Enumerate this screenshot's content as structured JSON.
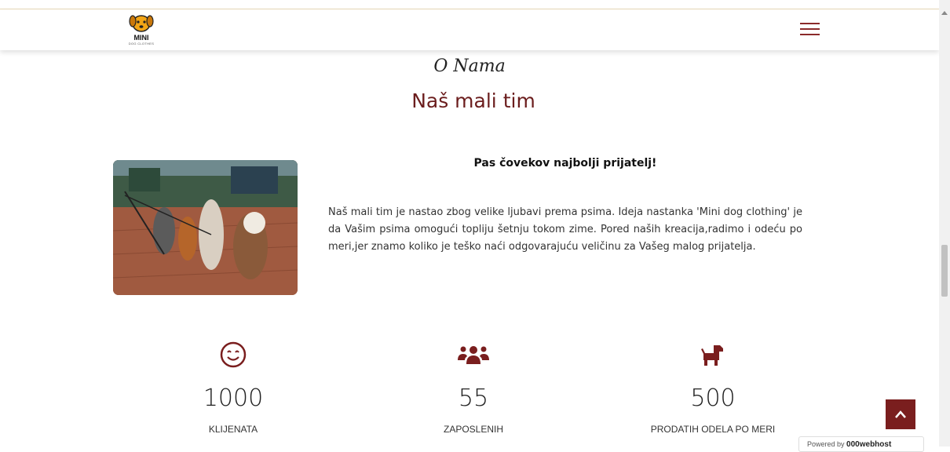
{
  "header": {
    "logo_title": "MINI",
    "logo_subtitle": "DOG CLOTHES",
    "menu_icon": "hamburger-icon"
  },
  "about": {
    "subtitle": "O Nama",
    "title": "Naš mali tim",
    "heading": "Pas čovekov najbolji prijatelj!",
    "text": "Naš mali tim je nastao zbog velike ljubavi prema psima. Ideja nastanka 'Mini dog clothing' je da Vašim psima omogući topliju šetnju tokom zime. Pored naših kreacija,radimo i odeću po meri,jer znamo koliko je teško naći odgovarajuću veličinu za Vašeg malog prijatelja."
  },
  "stats": [
    {
      "icon": "smile-icon",
      "number": "1000",
      "label": "KLIJENATA"
    },
    {
      "icon": "users-icon",
      "number": "55",
      "label": "ZAPOSLENIH"
    },
    {
      "icon": "dog-icon",
      "number": "500",
      "label": "PRODATIH ODELA PO MERI"
    }
  ],
  "badge": {
    "prefix": "Powered by",
    "brand": "000webhost"
  },
  "colors": {
    "accent": "#7a1e1e",
    "title": "#6b1d1d"
  }
}
